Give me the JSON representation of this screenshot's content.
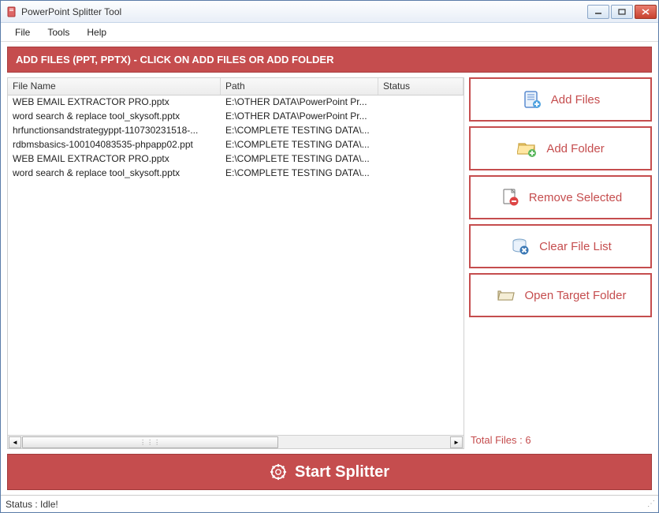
{
  "window": {
    "title": "PowerPoint Splitter Tool"
  },
  "menu": {
    "file": "File",
    "tools": "Tools",
    "help": "Help"
  },
  "banner": "ADD FILES (PPT, PPTX) - CLICK ON ADD FILES OR ADD FOLDER",
  "columns": {
    "filename": "File Name",
    "path": "Path",
    "status": "Status"
  },
  "rows": [
    {
      "filename": "WEB EMAIL EXTRACTOR PRO.pptx",
      "path": "E:\\OTHER DATA\\PowerPoint Pr...",
      "status": ""
    },
    {
      "filename": "word search & replace tool_skysoft.pptx",
      "path": "E:\\OTHER DATA\\PowerPoint Pr...",
      "status": ""
    },
    {
      "filename": "hrfunctionsandstrategyppt-110730231518-...",
      "path": "E:\\COMPLETE TESTING DATA\\...",
      "status": ""
    },
    {
      "filename": "rdbmsbasics-100104083535-phpapp02.ppt",
      "path": "E:\\COMPLETE TESTING DATA\\...",
      "status": ""
    },
    {
      "filename": "WEB EMAIL EXTRACTOR PRO.pptx",
      "path": "E:\\COMPLETE TESTING DATA\\...",
      "status": ""
    },
    {
      "filename": "word search & replace tool_skysoft.pptx",
      "path": "E:\\COMPLETE TESTING DATA\\...",
      "status": ""
    }
  ],
  "buttons": {
    "add_files": "Add Files",
    "add_folder": "Add Folder",
    "remove_selected": "Remove Selected",
    "clear_list": "Clear File List",
    "open_target": "Open Target Folder",
    "start": "Start Splitter"
  },
  "total_label": "Total Files : 6",
  "status": "Status  :  Idle!"
}
